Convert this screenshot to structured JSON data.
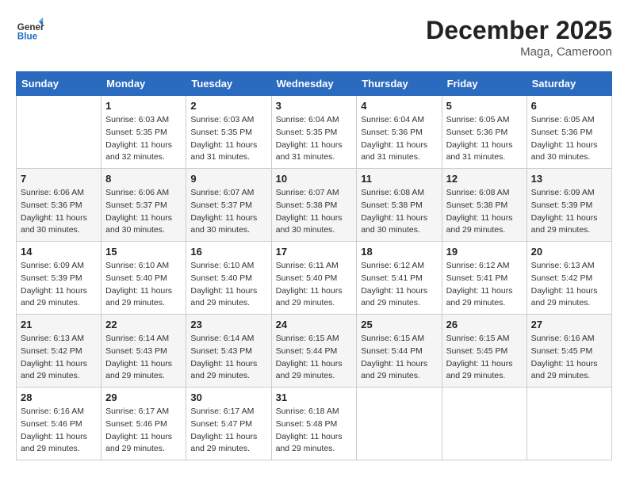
{
  "logo": {
    "line1": "General",
    "line2": "Blue"
  },
  "title": "December 2025",
  "location": "Maga, Cameroon",
  "days_header": [
    "Sunday",
    "Monday",
    "Tuesday",
    "Wednesday",
    "Thursday",
    "Friday",
    "Saturday"
  ],
  "weeks": [
    [
      {
        "day": "",
        "sunrise": "",
        "sunset": "",
        "daylight": ""
      },
      {
        "day": "1",
        "sunrise": "Sunrise: 6:03 AM",
        "sunset": "Sunset: 5:35 PM",
        "daylight": "Daylight: 11 hours and 32 minutes."
      },
      {
        "day": "2",
        "sunrise": "Sunrise: 6:03 AM",
        "sunset": "Sunset: 5:35 PM",
        "daylight": "Daylight: 11 hours and 31 minutes."
      },
      {
        "day": "3",
        "sunrise": "Sunrise: 6:04 AM",
        "sunset": "Sunset: 5:35 PM",
        "daylight": "Daylight: 11 hours and 31 minutes."
      },
      {
        "day": "4",
        "sunrise": "Sunrise: 6:04 AM",
        "sunset": "Sunset: 5:36 PM",
        "daylight": "Daylight: 11 hours and 31 minutes."
      },
      {
        "day": "5",
        "sunrise": "Sunrise: 6:05 AM",
        "sunset": "Sunset: 5:36 PM",
        "daylight": "Daylight: 11 hours and 31 minutes."
      },
      {
        "day": "6",
        "sunrise": "Sunrise: 6:05 AM",
        "sunset": "Sunset: 5:36 PM",
        "daylight": "Daylight: 11 hours and 30 minutes."
      }
    ],
    [
      {
        "day": "7",
        "sunrise": "Sunrise: 6:06 AM",
        "sunset": "Sunset: 5:36 PM",
        "daylight": "Daylight: 11 hours and 30 minutes."
      },
      {
        "day": "8",
        "sunrise": "Sunrise: 6:06 AM",
        "sunset": "Sunset: 5:37 PM",
        "daylight": "Daylight: 11 hours and 30 minutes."
      },
      {
        "day": "9",
        "sunrise": "Sunrise: 6:07 AM",
        "sunset": "Sunset: 5:37 PM",
        "daylight": "Daylight: 11 hours and 30 minutes."
      },
      {
        "day": "10",
        "sunrise": "Sunrise: 6:07 AM",
        "sunset": "Sunset: 5:38 PM",
        "daylight": "Daylight: 11 hours and 30 minutes."
      },
      {
        "day": "11",
        "sunrise": "Sunrise: 6:08 AM",
        "sunset": "Sunset: 5:38 PM",
        "daylight": "Daylight: 11 hours and 30 minutes."
      },
      {
        "day": "12",
        "sunrise": "Sunrise: 6:08 AM",
        "sunset": "Sunset: 5:38 PM",
        "daylight": "Daylight: 11 hours and 29 minutes."
      },
      {
        "day": "13",
        "sunrise": "Sunrise: 6:09 AM",
        "sunset": "Sunset: 5:39 PM",
        "daylight": "Daylight: 11 hours and 29 minutes."
      }
    ],
    [
      {
        "day": "14",
        "sunrise": "Sunrise: 6:09 AM",
        "sunset": "Sunset: 5:39 PM",
        "daylight": "Daylight: 11 hours and 29 minutes."
      },
      {
        "day": "15",
        "sunrise": "Sunrise: 6:10 AM",
        "sunset": "Sunset: 5:40 PM",
        "daylight": "Daylight: 11 hours and 29 minutes."
      },
      {
        "day": "16",
        "sunrise": "Sunrise: 6:10 AM",
        "sunset": "Sunset: 5:40 PM",
        "daylight": "Daylight: 11 hours and 29 minutes."
      },
      {
        "day": "17",
        "sunrise": "Sunrise: 6:11 AM",
        "sunset": "Sunset: 5:40 PM",
        "daylight": "Daylight: 11 hours and 29 minutes."
      },
      {
        "day": "18",
        "sunrise": "Sunrise: 6:12 AM",
        "sunset": "Sunset: 5:41 PM",
        "daylight": "Daylight: 11 hours and 29 minutes."
      },
      {
        "day": "19",
        "sunrise": "Sunrise: 6:12 AM",
        "sunset": "Sunset: 5:41 PM",
        "daylight": "Daylight: 11 hours and 29 minutes."
      },
      {
        "day": "20",
        "sunrise": "Sunrise: 6:13 AM",
        "sunset": "Sunset: 5:42 PM",
        "daylight": "Daylight: 11 hours and 29 minutes."
      }
    ],
    [
      {
        "day": "21",
        "sunrise": "Sunrise: 6:13 AM",
        "sunset": "Sunset: 5:42 PM",
        "daylight": "Daylight: 11 hours and 29 minutes."
      },
      {
        "day": "22",
        "sunrise": "Sunrise: 6:14 AM",
        "sunset": "Sunset: 5:43 PM",
        "daylight": "Daylight: 11 hours and 29 minutes."
      },
      {
        "day": "23",
        "sunrise": "Sunrise: 6:14 AM",
        "sunset": "Sunset: 5:43 PM",
        "daylight": "Daylight: 11 hours and 29 minutes."
      },
      {
        "day": "24",
        "sunrise": "Sunrise: 6:15 AM",
        "sunset": "Sunset: 5:44 PM",
        "daylight": "Daylight: 11 hours and 29 minutes."
      },
      {
        "day": "25",
        "sunrise": "Sunrise: 6:15 AM",
        "sunset": "Sunset: 5:44 PM",
        "daylight": "Daylight: 11 hours and 29 minutes."
      },
      {
        "day": "26",
        "sunrise": "Sunrise: 6:15 AM",
        "sunset": "Sunset: 5:45 PM",
        "daylight": "Daylight: 11 hours and 29 minutes."
      },
      {
        "day": "27",
        "sunrise": "Sunrise: 6:16 AM",
        "sunset": "Sunset: 5:45 PM",
        "daylight": "Daylight: 11 hours and 29 minutes."
      }
    ],
    [
      {
        "day": "28",
        "sunrise": "Sunrise: 6:16 AM",
        "sunset": "Sunset: 5:46 PM",
        "daylight": "Daylight: 11 hours and 29 minutes."
      },
      {
        "day": "29",
        "sunrise": "Sunrise: 6:17 AM",
        "sunset": "Sunset: 5:46 PM",
        "daylight": "Daylight: 11 hours and 29 minutes."
      },
      {
        "day": "30",
        "sunrise": "Sunrise: 6:17 AM",
        "sunset": "Sunset: 5:47 PM",
        "daylight": "Daylight: 11 hours and 29 minutes."
      },
      {
        "day": "31",
        "sunrise": "Sunrise: 6:18 AM",
        "sunset": "Sunset: 5:48 PM",
        "daylight": "Daylight: 11 hours and 29 minutes."
      },
      {
        "day": "",
        "sunrise": "",
        "sunset": "",
        "daylight": ""
      },
      {
        "day": "",
        "sunrise": "",
        "sunset": "",
        "daylight": ""
      },
      {
        "day": "",
        "sunrise": "",
        "sunset": "",
        "daylight": ""
      }
    ]
  ]
}
